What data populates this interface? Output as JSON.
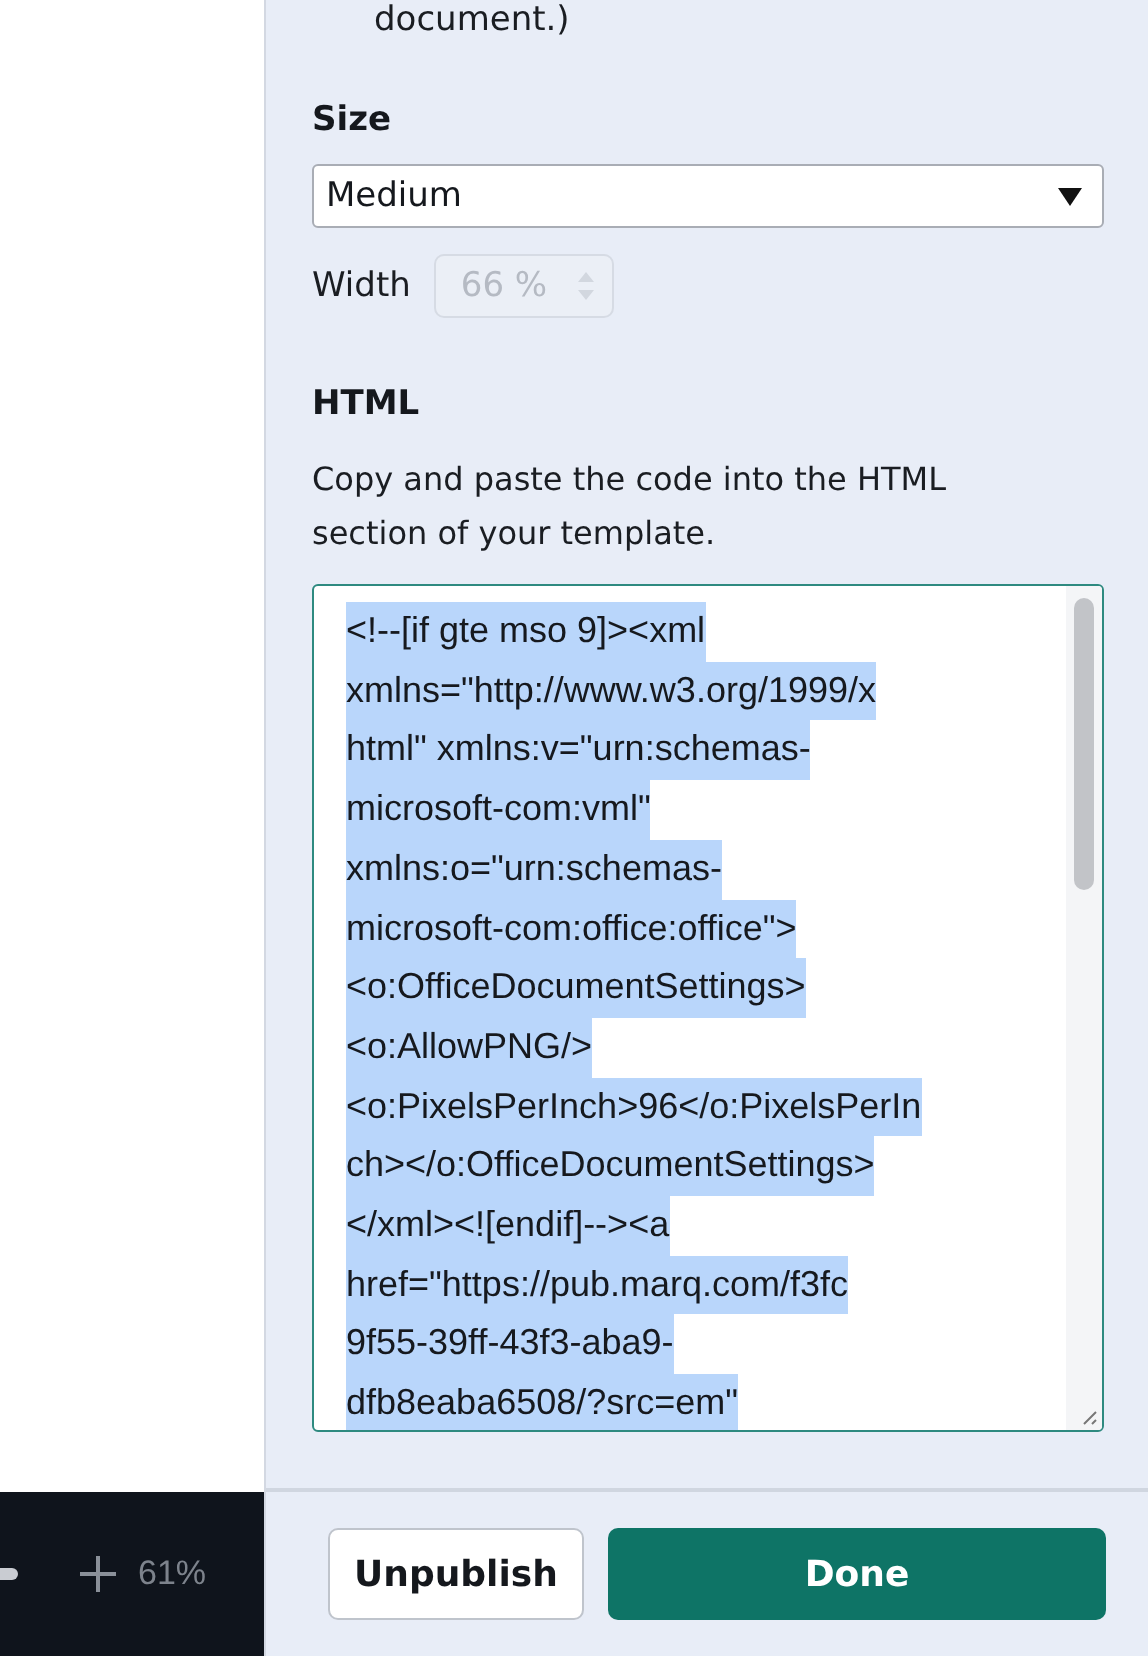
{
  "panel": {
    "intro_tail": "document.)",
    "size": {
      "label": "Size",
      "select": {
        "value": "Medium"
      },
      "width_label": "Width",
      "width_field": {
        "value": "66 %",
        "disabled": true
      }
    },
    "html": {
      "label": "HTML",
      "description": "Copy and paste the code into the HTML section of your template.",
      "code_lines": [
        "<!--[if gte mso 9]><xml",
        "xmlns=\"http://www.w3.org/1999/x",
        "html\" xmlns:v=\"urn:schemas-",
        "microsoft-com:vml\"",
        "xmlns:o=\"urn:schemas-",
        "microsoft-com:office:office\">",
        "<o:OfficeDocumentSettings>",
        "<o:AllowPNG/>",
        "<o:PixelsPerInch>96</o:PixelsPerIn",
        "ch></o:OfficeDocumentSettings>",
        "</xml><![endif]--><a",
        "href=\"https://pub.marq.com/f3fc",
        "9f55-39ff-43f3-aba9-",
        "dfb8eaba6508/?src=em\""
      ],
      "selected": true
    },
    "buttons": [
      {
        "label": "Unpublish",
        "kind": "secondary"
      },
      {
        "label": "Done",
        "kind": "primary"
      }
    ]
  },
  "zoom_bar": {
    "zoom": "61%"
  }
}
